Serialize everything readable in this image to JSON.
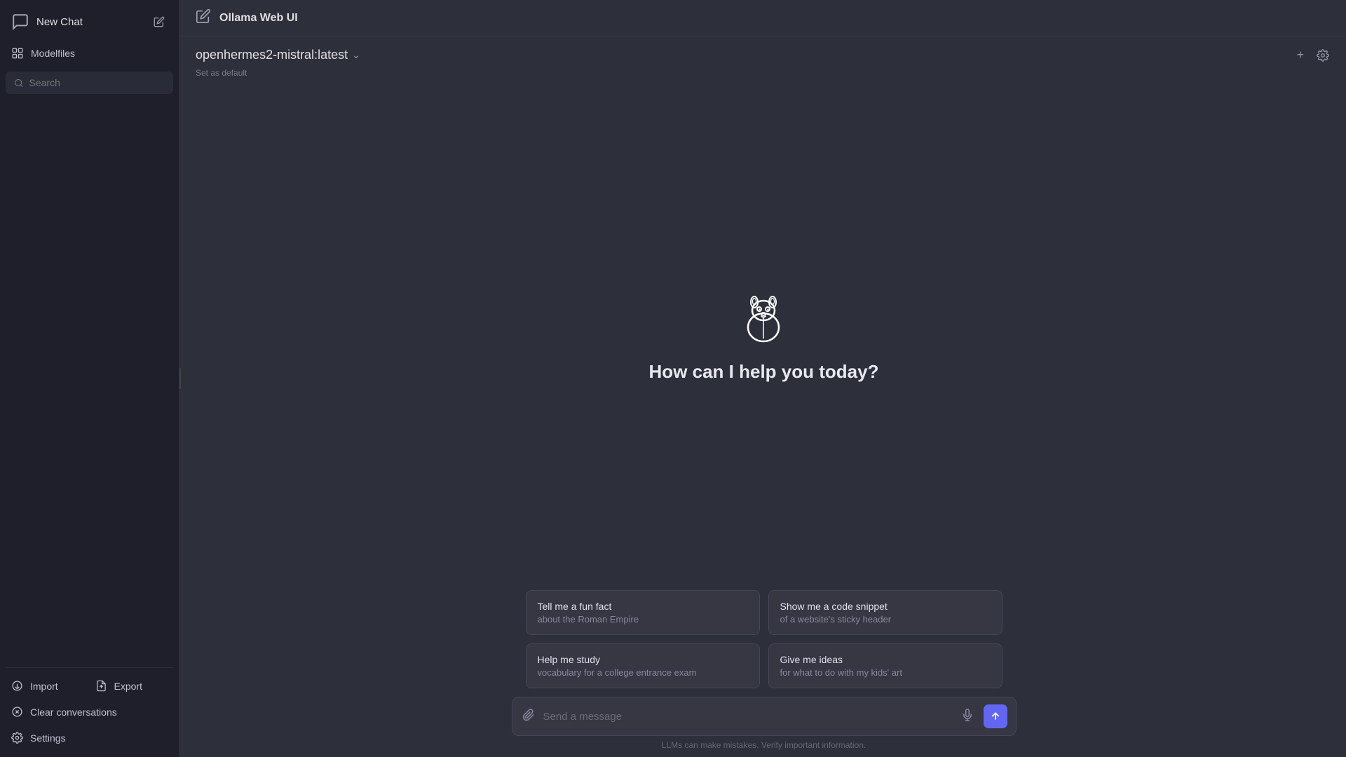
{
  "sidebar": {
    "new_chat_label": "New Chat",
    "modelfiles_label": "Modelfiles",
    "search_placeholder": "Search",
    "bottom_items": [
      {
        "id": "import",
        "label": "Import",
        "icon": "import-icon"
      },
      {
        "id": "export",
        "label": "Export",
        "icon": "export-icon"
      }
    ],
    "clear_label": "Clear conversations",
    "settings_label": "Settings"
  },
  "header": {
    "title": "Ollama Web UI"
  },
  "model_bar": {
    "model_name": "openhermes2-mistral:latest",
    "set_default_label": "Set as default"
  },
  "chat": {
    "welcome_text": "How can I help you today?"
  },
  "suggestions": [
    {
      "title": "Tell me a fun fact",
      "subtitle": "about the Roman Empire"
    },
    {
      "title": "Show me a code snippet",
      "subtitle": "of a website's sticky header"
    },
    {
      "title": "Help me study",
      "subtitle": "vocabulary for a college entrance exam"
    },
    {
      "title": "Give me ideas",
      "subtitle": "for what to do with my kids' art"
    }
  ],
  "input": {
    "placeholder": "Send a message",
    "disclaimer": "LLMs can make mistakes. Verify important information."
  }
}
